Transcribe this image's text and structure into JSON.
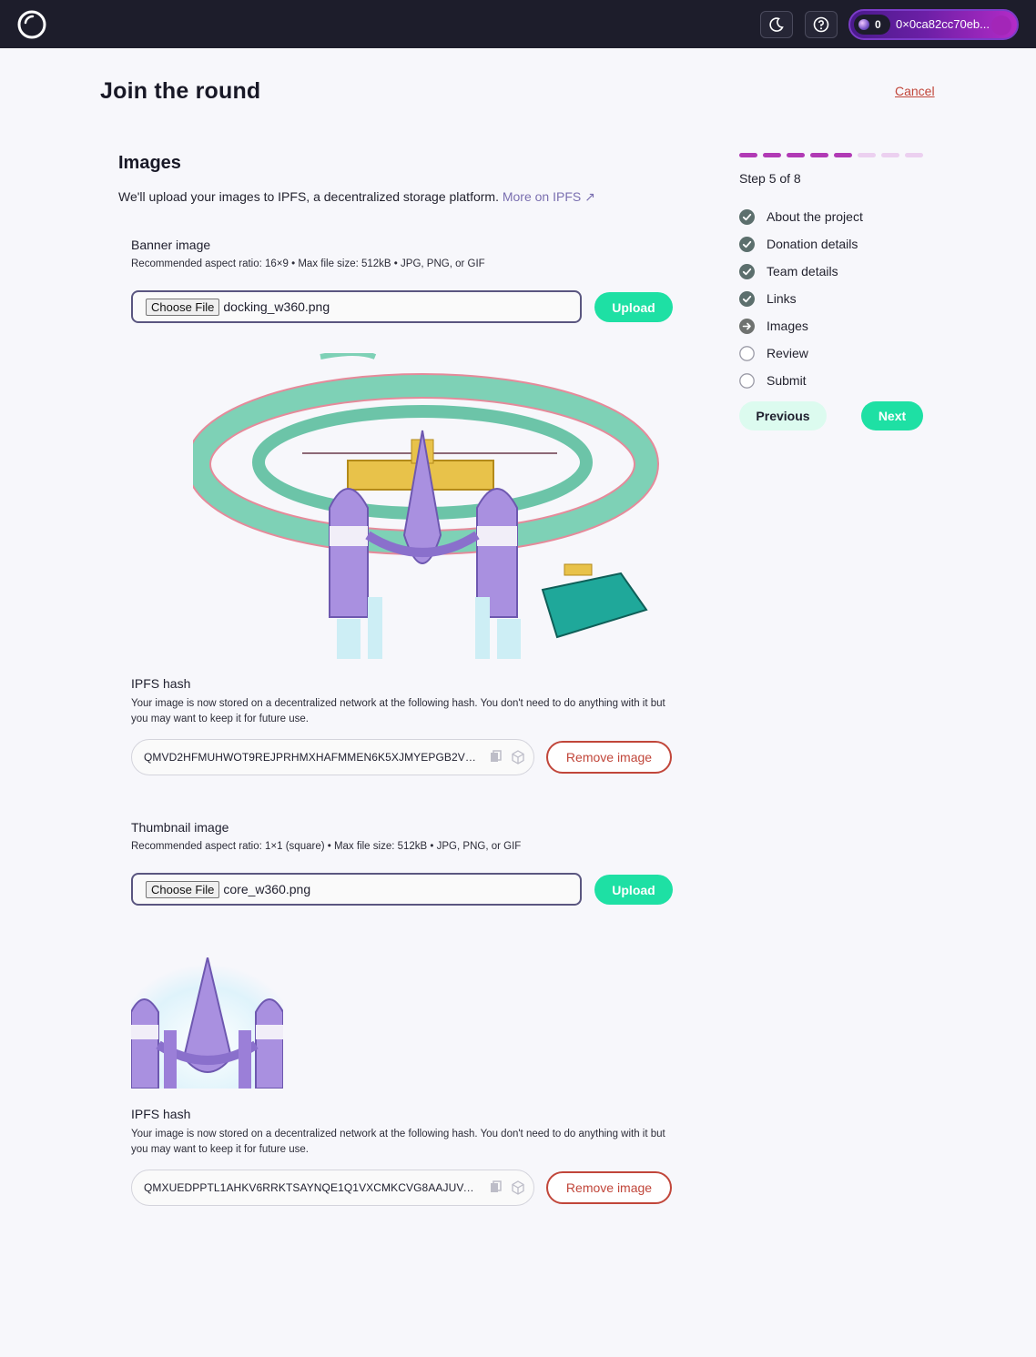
{
  "header": {
    "wallet_count": "0",
    "wallet_address": "0×0ca82cc70eb..."
  },
  "page": {
    "title": "Join the round",
    "cancel_label": "Cancel"
  },
  "section": {
    "title": "Images",
    "intro": "We'll upload your images to IPFS, a decentralized storage platform.",
    "intro_link": "More on IPFS ↗"
  },
  "banner": {
    "label": "Banner image",
    "hint": "Recommended aspect ratio: 16×9 • Max file size: 512kB • JPG, PNG, or GIF",
    "choose_label": "Choose File",
    "filename": "docking_w360.png",
    "upload_label": "Upload",
    "ipfs_label": "IPFS hash",
    "ipfs_text": "Your image is now stored on a decentralized network at the following hash. You don't need to do anything with it but you may want to keep it for future use.",
    "hash": "QMVD2HFMUHWOT9REJPRHMXHAFMMEN6K5XJMYEPGB2VU...",
    "remove_label": "Remove image"
  },
  "thumbnail": {
    "label": "Thumbnail image",
    "hint": "Recommended aspect ratio: 1×1 (square) • Max file size: 512kB • JPG, PNG, or GIF",
    "choose_label": "Choose File",
    "filename": "core_w360.png",
    "upload_label": "Upload",
    "ipfs_label": "IPFS hash",
    "ipfs_text": "Your image is now stored on a decentralized network at the following hash. You don't need to do anything with it but you may want to keep it for future use.",
    "hash": "QMXUEDPPTL1AHKV6RRKTSAYNQE1Q1VXCMKCVG8AAJUVAEF",
    "remove_label": "Remove image"
  },
  "stepper": {
    "step_text": "Step 5 of 8",
    "current_step": 5,
    "total_steps": 8,
    "steps": [
      {
        "label": "About the project",
        "status": "done"
      },
      {
        "label": "Donation details",
        "status": "done"
      },
      {
        "label": "Team details",
        "status": "done"
      },
      {
        "label": "Links",
        "status": "done"
      },
      {
        "label": "Images",
        "status": "current"
      },
      {
        "label": "Review",
        "status": "todo"
      },
      {
        "label": "Submit",
        "status": "todo"
      }
    ],
    "previous_label": "Previous",
    "next_label": "Next"
  },
  "colors": {
    "accent_green": "#1ee0a4",
    "danger": "#c1463a",
    "progress_active": "#b13ab5",
    "progress_inactive": "#ecd0f0"
  },
  "icons": [
    "logo-icon",
    "moon-icon",
    "help-icon",
    "copy-icon",
    "cube-icon",
    "check-circle-icon",
    "arrow-circle-icon",
    "empty-circle-icon"
  ]
}
